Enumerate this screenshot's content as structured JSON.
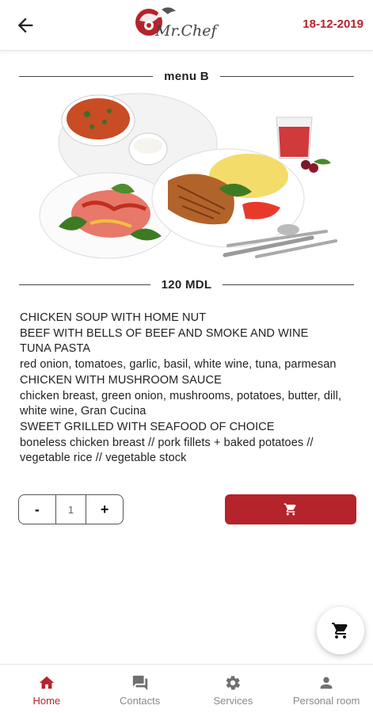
{
  "header": {
    "logo_text": "Mr.Chef",
    "date": "18-12-2019"
  },
  "menu": {
    "title": "menu B",
    "price": "120 MDL",
    "description_lines": [
      "CHICKEN SOUP WITH HOME NUT",
      "BEEF WITH BELLS OF BEEF AND SMOKE AND WINE",
      "TUNA PASTA",
      "red onion, tomatoes, garlic, basil, white wine, tuna, parmesan",
      "CHICKEN WITH MUSHROOM SAUCE",
      "chicken breast, green onion, mushrooms, potatoes, butter, dill, white wine, Gran Cucina",
      "SWEET GRILLED WITH SEAFOOD OF CHOICE",
      "boneless chicken breast // pork fillets + baked potatoes // vegetable rice // vegetable stock"
    ]
  },
  "stepper": {
    "minus": "-",
    "quantity": "1",
    "plus": "+"
  },
  "icons": {
    "back": "arrow-left-icon",
    "cart": "cart-icon"
  },
  "bottom_nav": {
    "items": [
      {
        "label": "Home",
        "icon": "home-icon",
        "active": true
      },
      {
        "label": "Contacts",
        "icon": "chat-icon",
        "active": false
      },
      {
        "label": "Services",
        "icon": "gear-icon",
        "active": false
      },
      {
        "label": "Personal room",
        "icon": "person-icon",
        "active": false
      }
    ]
  },
  "colors": {
    "accent": "#b5232b",
    "inactive": "#8a8a8a"
  }
}
